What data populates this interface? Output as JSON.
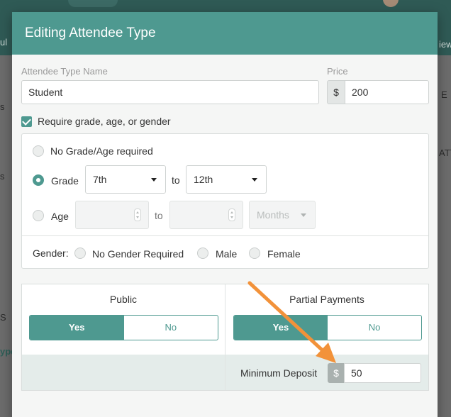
{
  "modal": {
    "title": "Editing Attendee Type",
    "name_label": "Attendee Type Name",
    "name_value": "Student",
    "price_label": "Price",
    "currency_symbol": "$",
    "price_value": "200",
    "require_label": "Require grade, age, or gender",
    "no_grade_label": "No Grade/Age required",
    "grade_label": "Grade",
    "grade_from": "7th",
    "to_label": "to",
    "grade_to": "12th",
    "age_label": "Age",
    "age_unit": "Months",
    "gender_label": "Gender:",
    "gender_options": [
      "No Gender Required",
      "Male",
      "Female"
    ],
    "public_label": "Public",
    "partial_label": "Partial Payments",
    "yes_label": "Yes",
    "no_label": "No",
    "deposit_label": "Minimum Deposit",
    "deposit_value": "50"
  },
  "background": {
    "fragments": [
      "ul",
      "s",
      "s",
      "S",
      "ype",
      "E",
      "ATT",
      "iew"
    ]
  },
  "colors": {
    "accent": "#4e9990",
    "annotation_arrow": "#f2923a"
  }
}
